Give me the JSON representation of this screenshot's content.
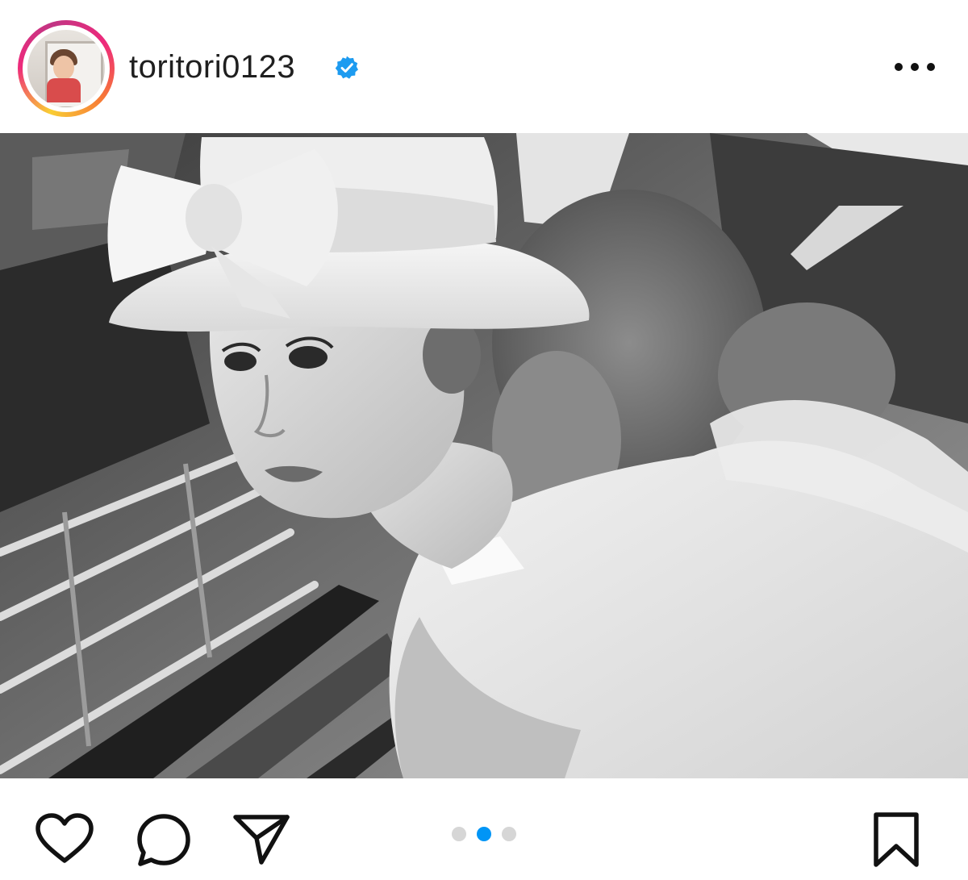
{
  "post": {
    "username": "toritori0123",
    "verified": true,
    "avatar_icon": "profile-photo",
    "more_icon": "more-options-icon",
    "image_alt": ""
  },
  "carousel": {
    "total": 3,
    "active_index": 1,
    "active_color": "#0095f6",
    "inactive_color": "#d6d6d6"
  },
  "actions": {
    "like_icon": "heart-icon",
    "comment_icon": "comment-icon",
    "share_icon": "send-icon",
    "save_icon": "bookmark-icon"
  },
  "colors": {
    "verified_badge": "#1d9bf0",
    "ring_gradient": [
      "#f9ce34",
      "#ee2a7b",
      "#c13584"
    ]
  }
}
